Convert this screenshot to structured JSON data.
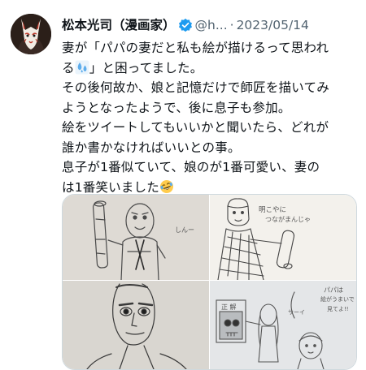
{
  "author": {
    "name": "松本光司（漫画家）",
    "handle": "@h...",
    "separator": "·",
    "date": "2023/05/14",
    "avatar_icon": "fox-mask-avatar",
    "verified_icon": "verified-badge-icon",
    "verified_color": "#1d9bf0"
  },
  "tweet": {
    "line1": "妻が「パパの妻だと私も絵が描けるって思われ",
    "line2a": "る",
    "line2_emoji": "sweat-droplets-emoji",
    "line2b": "」と困ってました。",
    "line3": "その後何故か、娘と記憶だけで師匠を描いてみ",
    "line4": "ようとなったようで、後に息子も参加。",
    "line5": "絵をツイートしてもいいかと聞いたら、どれが",
    "line6": "誰か書かなければいいとの事。",
    "line7": "息子が1番似ていて、娘のが1番可愛い、妻の",
    "line8a": "は1番笑いました",
    "line8_emoji": "rolling-on-floor-laughing-emoji"
  },
  "media": {
    "image1": {
      "drawing": "pencil-figure-with-log",
      "text": "しんー"
    },
    "image2": {
      "drawing": "kimono-figure-with-scroll",
      "text1": "明こやに",
      "text2": "つながまんじゃ"
    },
    "image3": {
      "drawing": "face-with-dark-eyes"
    },
    "image4": {
      "drawing": "figures-and-portrait",
      "sign": "正 解",
      "text1": "サーイ",
      "text2": "パパは",
      "text3": "絵がうまいで",
      "text4": "見てよ!!"
    }
  }
}
